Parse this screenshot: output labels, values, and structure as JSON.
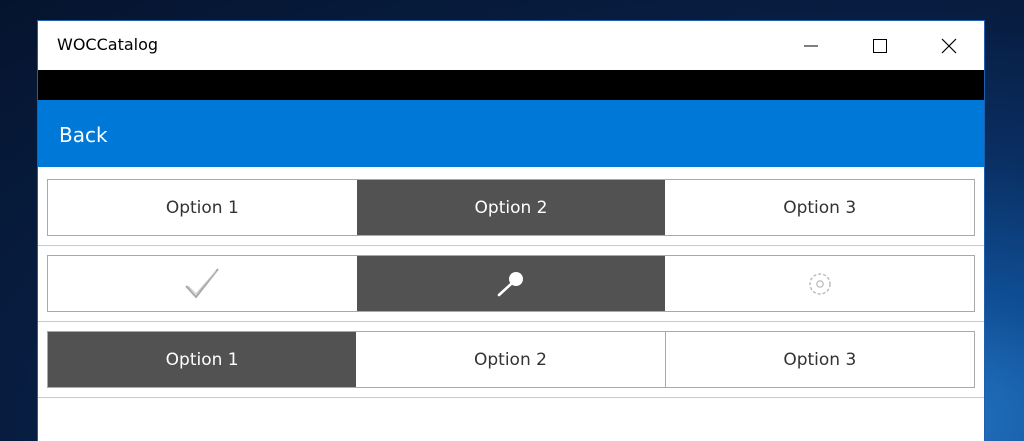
{
  "window": {
    "title": "WOCCatalog",
    "minimize_icon": "minimize-icon",
    "maximize_icon": "maximize-icon",
    "close_icon": "close-icon"
  },
  "navbar": {
    "back_label": "Back",
    "color": "#0078d7"
  },
  "segmented_text_1": {
    "items": [
      "Option 1",
      "Option 2",
      "Option 3"
    ],
    "selected_index": 1
  },
  "segmented_icons": {
    "items": [
      "check-icon",
      "search-icon",
      "gear-icon"
    ],
    "selected_index": 1
  },
  "segmented_text_2": {
    "items": [
      "Option 1",
      "Option 2",
      "Option 3"
    ],
    "selected_index": 0
  },
  "colors": {
    "selected_segment": "#525252",
    "segment_border": "#a9a9a9",
    "accent": "#0078d7"
  }
}
